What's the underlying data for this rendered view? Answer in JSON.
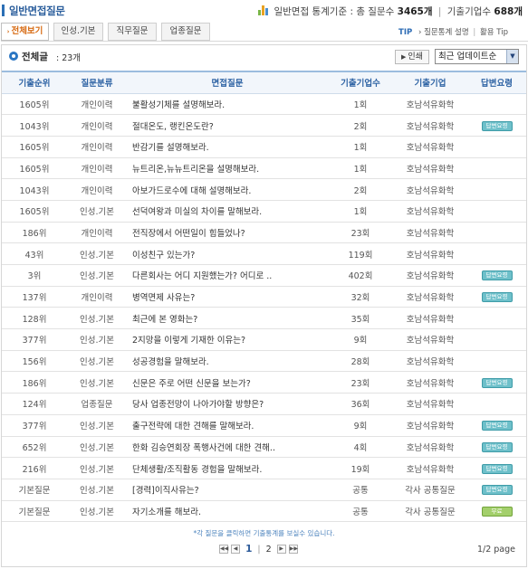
{
  "header": {
    "title": "일반면접질문",
    "stats_prefix": "일반면접 통계기준 : 총 질문수",
    "question_count": "3465개",
    "company_prefix": "기출기업수",
    "company_count": "688개",
    "icon": "bar-chart-icon"
  },
  "tabs": [
    {
      "label": "전체보기",
      "active": true
    },
    {
      "label": "인성.기본",
      "active": false
    },
    {
      "label": "직무질문",
      "active": false
    },
    {
      "label": "업종질문",
      "active": false
    }
  ],
  "tip": {
    "label": "TIP",
    "link1": "질문통계 설명",
    "link2": "활용 Tip"
  },
  "summary": {
    "label": "전체글",
    "value": ": 23개",
    "print_label": "인쇄",
    "sort_value": "최근 업데이트순"
  },
  "table": {
    "headers": [
      "기출순위",
      "질문분류",
      "면접질문",
      "기출기업수",
      "기출기업",
      "답변요령"
    ],
    "rows": [
      {
        "rank": "1605위",
        "cat": "개인이력",
        "q": "불활성기체를 설명해보라.",
        "cnt": "1회",
        "co": "호남석유화학",
        "ans": ""
      },
      {
        "rank": "1043위",
        "cat": "개인이력",
        "q": "절대온도, 랭킨온도란?",
        "cnt": "2회",
        "co": "호남석유화학",
        "ans": "답변요령"
      },
      {
        "rank": "1605위",
        "cat": "개인이력",
        "q": "반감기를 설명해보라.",
        "cnt": "1회",
        "co": "호남석유화학",
        "ans": ""
      },
      {
        "rank": "1605위",
        "cat": "개인이력",
        "q": "뉴트리온,뉴뉴트리온을 설명해보라.",
        "cnt": "1회",
        "co": "호남석유화학",
        "ans": ""
      },
      {
        "rank": "1043위",
        "cat": "개인이력",
        "q": "아보가드로수에 대해 설명해보라.",
        "cnt": "2회",
        "co": "호남석유화학",
        "ans": ""
      },
      {
        "rank": "1605위",
        "cat": "인성.기본",
        "q": "선덕여왕과 미실의 차이를 말해보라.",
        "cnt": "1회",
        "co": "호남석유화학",
        "ans": ""
      },
      {
        "rank": "186위",
        "cat": "개인이력",
        "q": "전직장에서 어떤일이 힘들었나?",
        "cnt": "23회",
        "co": "호남석유화학",
        "ans": ""
      },
      {
        "rank": "43위",
        "cat": "인성.기본",
        "q": "이성친구 있는가?",
        "cnt": "119회",
        "co": "호남석유화학",
        "ans": ""
      },
      {
        "rank": "3위",
        "cat": "인성.기본",
        "q": "다른회사는 어디 지원했는가? 어디로 ..",
        "cnt": "402회",
        "co": "호남석유화학",
        "ans": "답변요령"
      },
      {
        "rank": "137위",
        "cat": "개인이력",
        "q": "병역면제 사유는?",
        "cnt": "32회",
        "co": "호남석유화학",
        "ans": "답변요령"
      },
      {
        "rank": "128위",
        "cat": "인성.기본",
        "q": "최근에 본 영화는?",
        "cnt": "35회",
        "co": "호남석유화학",
        "ans": ""
      },
      {
        "rank": "377위",
        "cat": "인성.기본",
        "q": "2지망을 이렇게 기재한 이유는?",
        "cnt": "9회",
        "co": "호남석유화학",
        "ans": ""
      },
      {
        "rank": "156위",
        "cat": "인성.기본",
        "q": "성공경험을 말해보라.",
        "cnt": "28회",
        "co": "호남석유화학",
        "ans": ""
      },
      {
        "rank": "186위",
        "cat": "인성.기본",
        "q": "신문은 주로 어떤 신문을 보는가?",
        "cnt": "23회",
        "co": "호남석유화학",
        "ans": "답변요령"
      },
      {
        "rank": "124위",
        "cat": "업종질문",
        "q": "당사 업종전망이 나아가야할 방향은?",
        "cnt": "36회",
        "co": "호남석유화학",
        "ans": ""
      },
      {
        "rank": "377위",
        "cat": "인성.기본",
        "q": "출구전략에 대한 견해를 말해보라.",
        "cnt": "9회",
        "co": "호남석유화학",
        "ans": "답변요령"
      },
      {
        "rank": "652위",
        "cat": "인성.기본",
        "q": "한화 김승연회장 폭행사건에 대한 견해..",
        "cnt": "4회",
        "co": "호남석유화학",
        "ans": "답변요령"
      },
      {
        "rank": "216위",
        "cat": "인성.기본",
        "q": "단체생활/조직활동 경험을 말해보라.",
        "cnt": "19회",
        "co": "호남석유화학",
        "ans": "답변요령"
      },
      {
        "rank": "기본질문",
        "cat": "인성.기본",
        "q": "[경력]이직사유는?",
        "cnt": "공통",
        "co": "각사 공통질문",
        "ans": "답변요령"
      },
      {
        "rank": "기본질문",
        "cat": "인성.기본",
        "q": "자기소개를 해보라.",
        "cnt": "공통",
        "co": "각사 공통질문",
        "ans": "무료"
      }
    ]
  },
  "footer": {
    "note": "*각 질문을 클릭하면 기출통계를 보실수 있습니다.",
    "pages": [
      "1",
      "2"
    ],
    "current_page": "1",
    "page_info": "1/2 page"
  },
  "colors": {
    "accent_blue": "#2e63a4",
    "active_tab": "#d76a12",
    "badge_blue": "#6ec0ca",
    "badge_green": "#a3cf6b"
  }
}
